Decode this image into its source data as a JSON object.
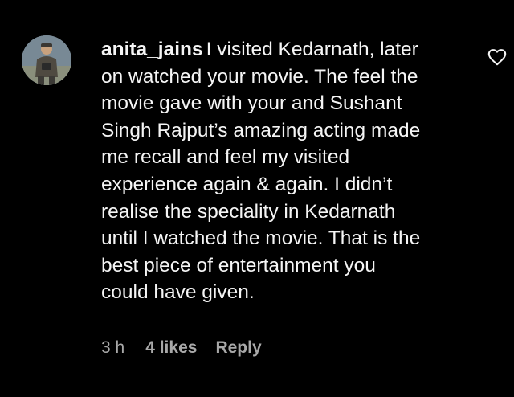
{
  "comment": {
    "username": "anita_jains",
    "text": "I visited Kedarnath, later\non watched your movie. The feel the\nmovie gave with your and Sushant\nSingh Rajput’s amazing acting made\nme recall and feel my visited\nexperience again & again. I didn’t\nrealise the speciality in Kedarnath\nuntil I watched the movie. That is the\nbest piece of entertainment you\ncould have given.",
    "time": "3 h",
    "likes": "4 likes",
    "reply_label": "Reply",
    "like_icon": "heart-outline-icon"
  },
  "colors": {
    "background": "#000000",
    "text": "#f5f5f5",
    "muted": "#a8a8a8"
  }
}
